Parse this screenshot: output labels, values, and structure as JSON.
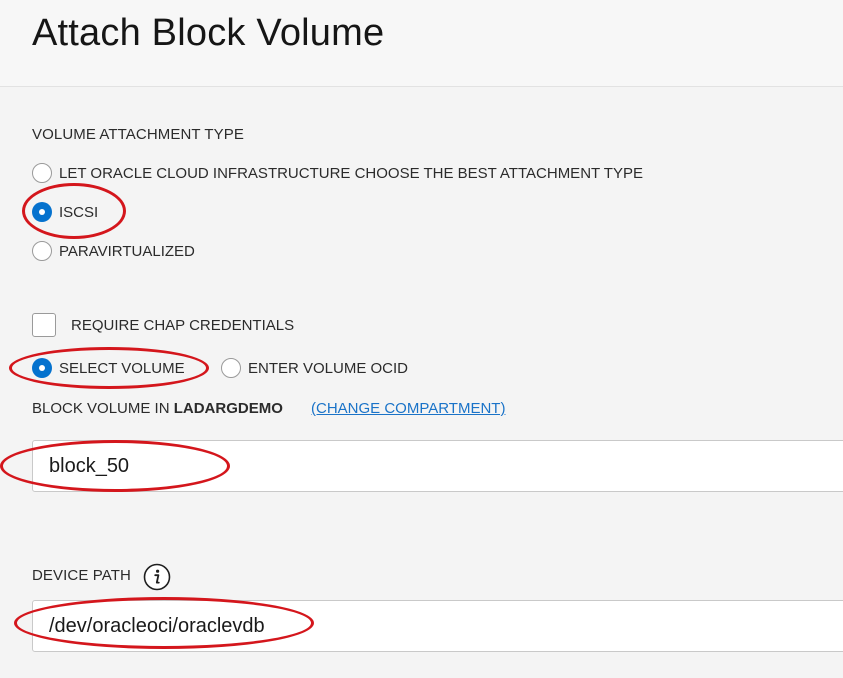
{
  "header": {
    "title": "Attach Block Volume"
  },
  "attachment_type": {
    "label": "VOLUME ATTACHMENT TYPE",
    "options": [
      {
        "label": "LET ORACLE CLOUD INFRASTRUCTURE CHOOSE THE BEST ATTACHMENT TYPE",
        "selected": false
      },
      {
        "label": "ISCSI",
        "selected": true
      },
      {
        "label": "PARAVIRTUALIZED",
        "selected": false
      }
    ]
  },
  "chap": {
    "label": "REQUIRE CHAP CREDENTIALS",
    "checked": false
  },
  "volume_source": {
    "options": [
      {
        "label": "SELECT VOLUME",
        "selected": true
      },
      {
        "label": "ENTER VOLUME OCID",
        "selected": false
      }
    ]
  },
  "block_volume": {
    "label_prefix": "BLOCK VOLUME IN",
    "compartment": "LADARGDEMO",
    "change_link": "(CHANGE COMPARTMENT)",
    "value": "block_50"
  },
  "device_path": {
    "label": "DEVICE PATH",
    "value": "/dev/oracleoci/oraclevdb",
    "info_icon": "info-icon"
  },
  "colors": {
    "accent": "#0572ce",
    "link": "#1a73c8",
    "annotation": "#d4161c"
  }
}
